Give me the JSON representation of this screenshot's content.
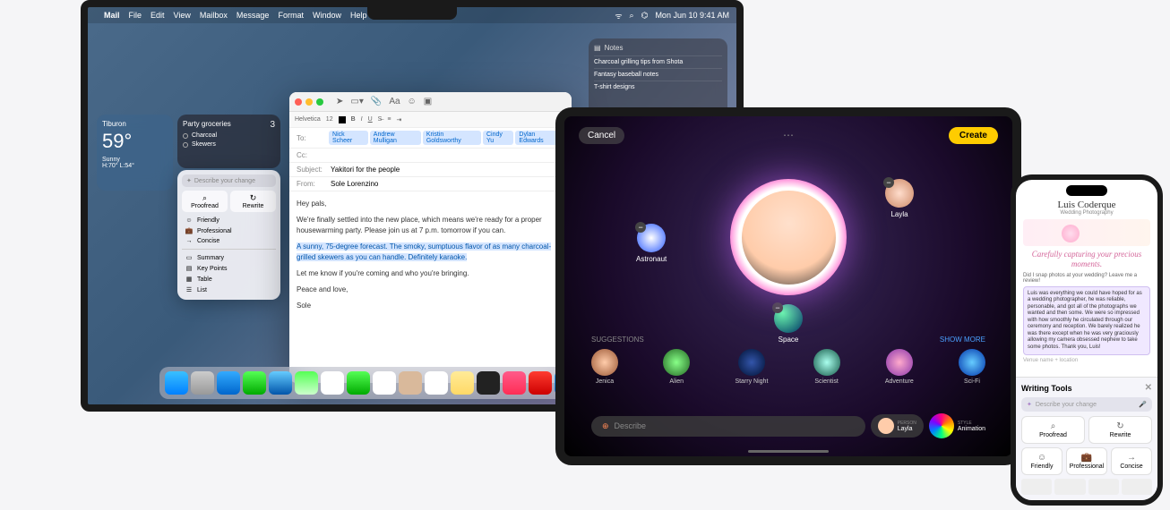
{
  "menubar": {
    "apple": "",
    "app": "Mail",
    "items": [
      "File",
      "Edit",
      "View",
      "Mailbox",
      "Message",
      "Format",
      "Window",
      "Help"
    ],
    "clock": "Mon Jun 10  9:41 AM"
  },
  "weather": {
    "location": "Tiburon",
    "temp": "59°",
    "condition": "Sunny",
    "hilo": "H:70° L:54°"
  },
  "reminders": {
    "title": "Party groceries",
    "count": "3",
    "items": [
      "Charcoal",
      "Skewers"
    ]
  },
  "notes": {
    "title": "Notes",
    "items": [
      "Charcoal grilling tips from Shota",
      "Fantasy baseball notes",
      "T-shirt designs"
    ]
  },
  "wt_mac": {
    "describe": "Describe your change",
    "proofread": "Proofread",
    "rewrite": "Rewrite",
    "friendly": "Friendly",
    "professional": "Professional",
    "concise": "Concise",
    "summary": "Summary",
    "keypoints": "Key Points",
    "table": "Table",
    "list": "List"
  },
  "mail": {
    "font": "Helvetica",
    "size": "12",
    "to_label": "To:",
    "to": [
      "Nick Scheer",
      "Andrew Mulligan",
      "Kristin Goldsworthy",
      "Cindy Yu",
      "Dylan Edwards"
    ],
    "cc_label": "Cc:",
    "subject_label": "Subject:",
    "subject": "Yakitori for the people",
    "from_label": "From:",
    "from": "Sole Lorenzino",
    "body": {
      "p1": "Hey pals,",
      "p2": "We're finally settled into the new place, which means we're ready for a proper housewarming party. Please join us at 7 p.m. tomorrow if you can.",
      "p3": "A sunny, 75-degree forecast. The smoky, sumptuous flavor of as many charcoal-grilled skewers as you can handle. Definitely karaoke.",
      "p4": "Let me know if you're coming and who you're bringing.",
      "p5": "Peace and love,",
      "p6": "Sole"
    }
  },
  "ipad": {
    "cancel": "Cancel",
    "create": "Create",
    "orbits": {
      "astronaut": "Astronaut",
      "layla": "Layla",
      "space": "Space"
    },
    "suggestions_label": "SUGGESTIONS",
    "show_more": "SHOW MORE",
    "suggestions": [
      "Jenica",
      "Alien",
      "Starry Night",
      "Scientist",
      "Adventure",
      "Sci-Fi"
    ],
    "describe_placeholder": "Describe",
    "person_label": "PERSON",
    "person_name": "Layla",
    "style_label": "STYLE",
    "style_name": "Animation"
  },
  "iphone": {
    "name": "Luis Coderque",
    "role": "Wedding Photography",
    "tagline": "Carefully capturing your precious moments.",
    "prompt": "Did I snap photos at your wedding? Leave me a review!",
    "review": "Luis was everything we could have hoped for as a wedding photographer, he was reliable, personable, and got all of the photographs we wanted and then some. We were so impressed with how smoothly he circulated through our ceremony and reception. We barely realized he was there except when he was very graciously allowing my camera obsessed nephew to take some photos. Thank you, Luis!",
    "venue": "Venue name + location",
    "wt": {
      "title": "Writing Tools",
      "describe": "Describe your change",
      "proofread": "Proofread",
      "rewrite": "Rewrite",
      "friendly": "Friendly",
      "professional": "Professional",
      "concise": "Concise"
    }
  }
}
